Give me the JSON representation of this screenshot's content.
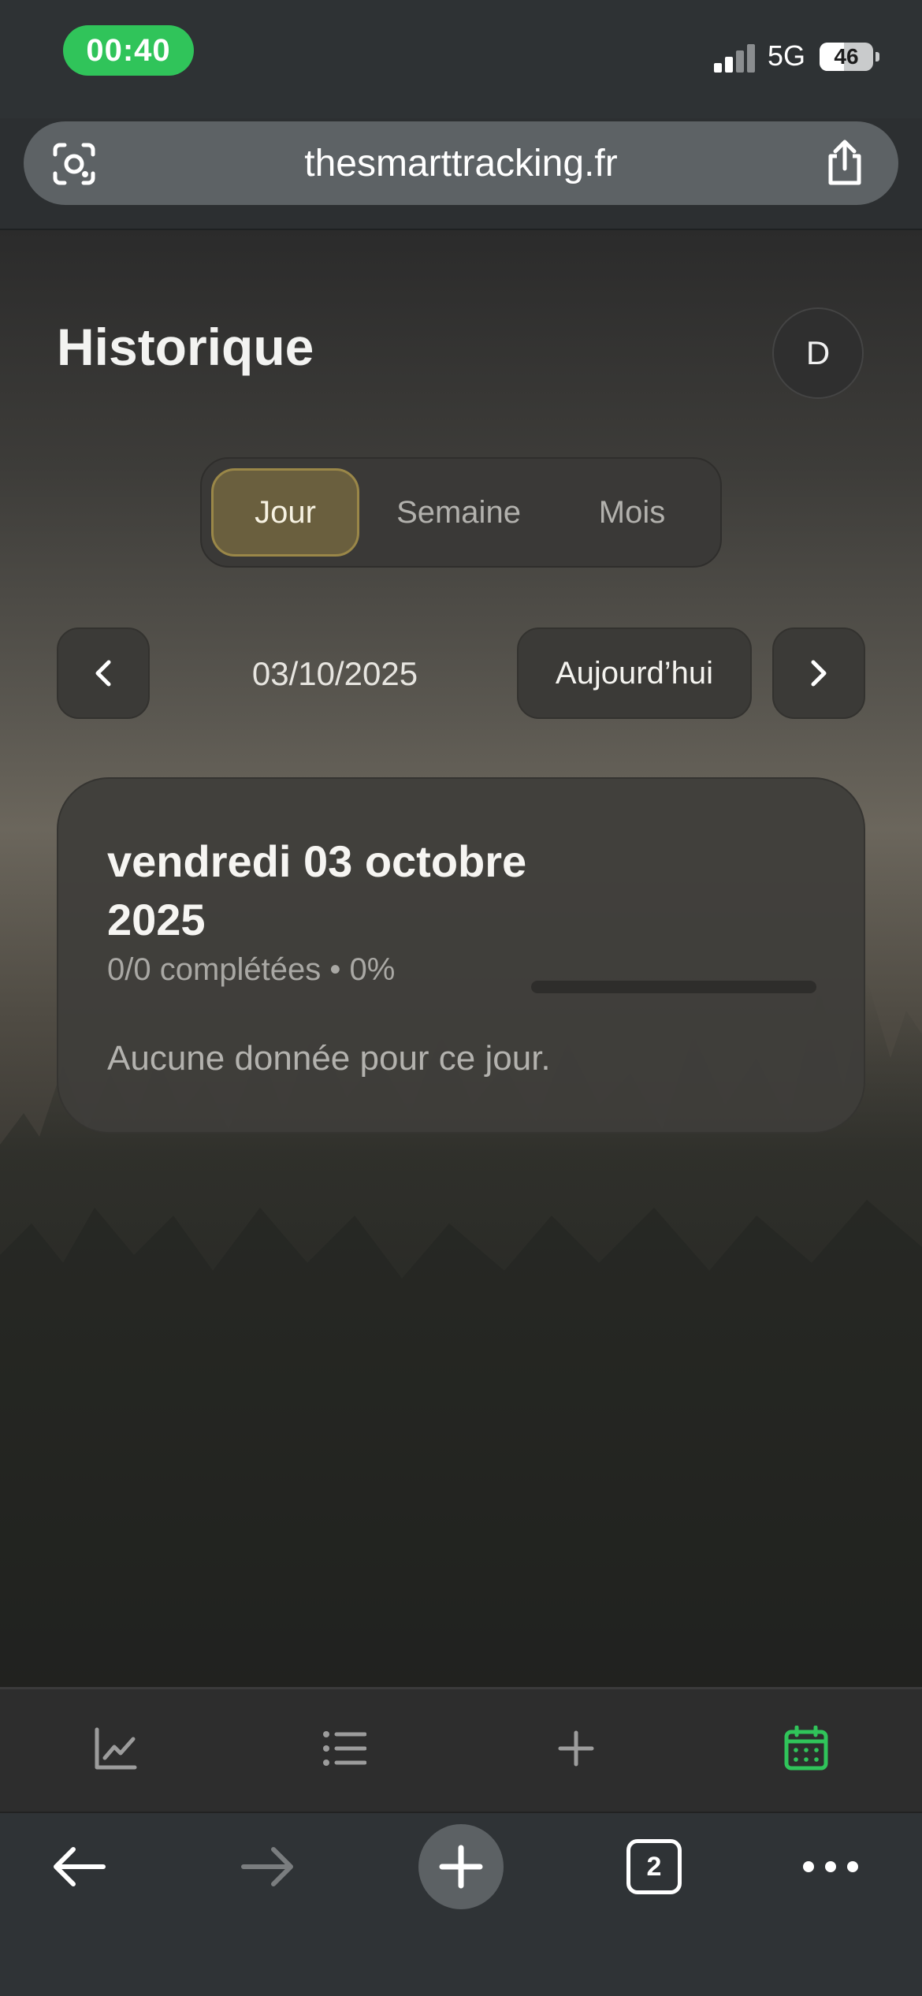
{
  "status_bar": {
    "time": "00:40",
    "network": "5G",
    "battery_percent": "46",
    "battery_level": 0.46,
    "signal_bars_active": 2,
    "signal_bars_total": 4
  },
  "browser": {
    "url": "thesmarttracking.fr",
    "open_tab_count": "2"
  },
  "header": {
    "title": "Historique",
    "avatar_initial": "D"
  },
  "period_tabs": {
    "items": [
      {
        "label": "Jour",
        "active": true
      },
      {
        "label": "Semaine",
        "active": false
      },
      {
        "label": "Mois",
        "active": false
      }
    ]
  },
  "date_nav": {
    "current_date": "03/10/2025",
    "today_label": "Aujourd’hui"
  },
  "day_card": {
    "title": "vendredi 03 octobre 2025",
    "summary": "0/0 complétées • 0%",
    "progress": 0,
    "empty_message": "Aucune donnée pour ce jour."
  },
  "app_tabs": [
    {
      "icon": "chart-line-icon",
      "active": false
    },
    {
      "icon": "list-icon",
      "active": false
    },
    {
      "icon": "plus-icon",
      "active": false
    },
    {
      "icon": "calendar-icon",
      "active": true
    }
  ],
  "colors": {
    "accent_active_tab": "#30c45a",
    "segment_active_bg": "#6a5f3e",
    "segment_active_border": "#9a8748"
  }
}
